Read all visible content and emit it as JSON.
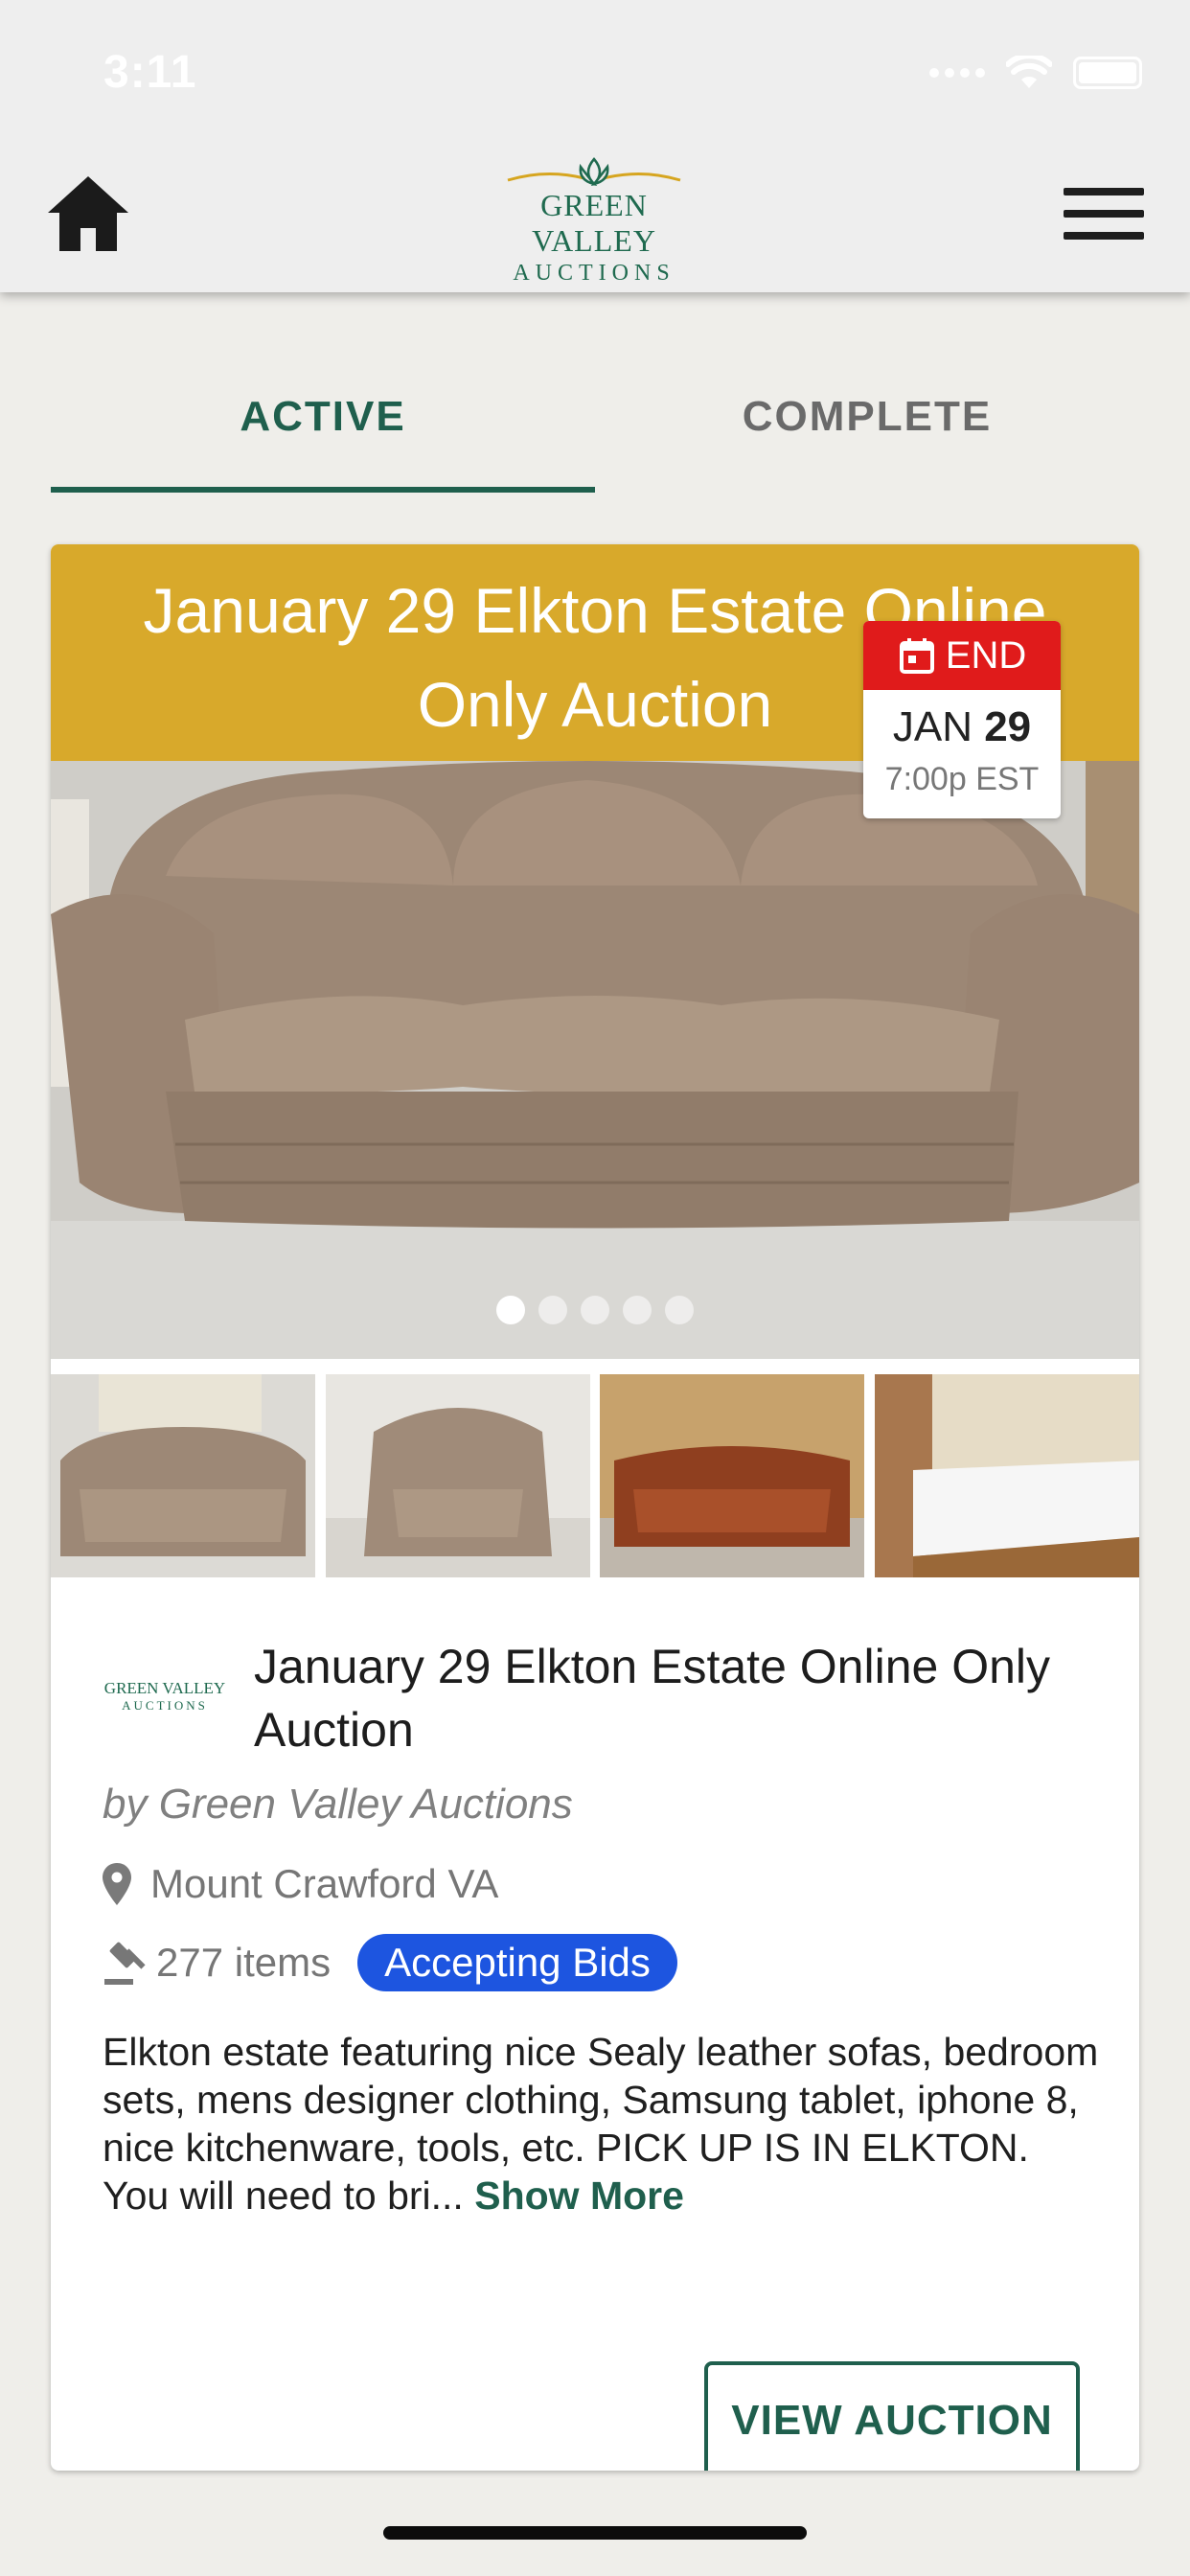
{
  "status_bar": {
    "time": "3:11"
  },
  "header": {
    "logo_line1": "GREEN VALLEY",
    "logo_line2": "AUCTIONS"
  },
  "tabs": [
    {
      "label": "ACTIVE",
      "selected": true
    },
    {
      "label": "COMPLETE",
      "selected": false
    }
  ],
  "auction": {
    "banner_title": "January 29 Elkton Estate Online Only Auction",
    "end_badge": {
      "label": "END",
      "month": "JAN",
      "day": "29",
      "time": "7:00p EST"
    },
    "carousel": {
      "page_count": 5,
      "current_page": 1
    },
    "thumbnails": [
      "taupe-leather-sofa",
      "taupe-leather-armchair",
      "brown-leather-sofa",
      "bed-with-mattress"
    ],
    "title": "January 29 Elkton Estate Online Only Auction",
    "mini_logo_line1": "GREEN VALLEY",
    "mini_logo_line2": "AUCTIONS",
    "seller": "by Green Valley Auctions",
    "location": "Mount Crawford VA",
    "items_count": "277 items",
    "status": "Accepting Bids",
    "description": "Elkton estate featuring nice Sealy leather sofas, bedroom sets, mens designer clothing, Samsung tablet, iphone 8, nice kitchenware, tools, etc. PICK UP IS IN ELKTON. You will need to bri...",
    "show_more": "Show More",
    "view_button": "VIEW AUCTION"
  },
  "colors": {
    "brand_green": "#1f5f4d",
    "banner_gold": "#d8a92b",
    "end_red": "#e01b1b",
    "status_blue": "#1d55e0"
  }
}
